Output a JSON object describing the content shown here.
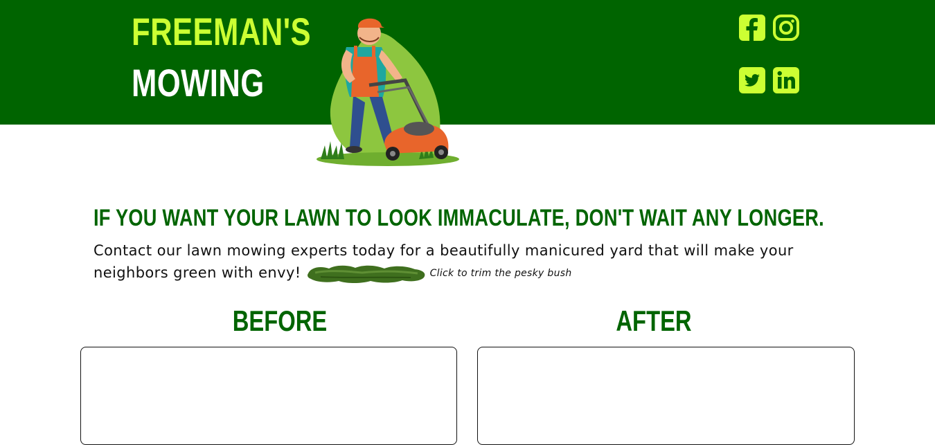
{
  "header": {
    "brand_line1": "FREEMAN'S",
    "brand_line2": "MOWING",
    "colors": {
      "background": "#006400",
      "accent": "#ccff33",
      "white": "#ffffff"
    },
    "social_icons": [
      "facebook-icon",
      "instagram-icon",
      "twitter-icon",
      "linkedin-icon"
    ]
  },
  "hero": {
    "headline": "IF YOU WANT YOUR LAWN TO LOOK IMMACULATE, DON'T WAIT ANY LONGER.",
    "body": "Contact our lawn mowing experts today for a beautifully manicured yard that will make your neighbors green with envy!",
    "bush_hint": "Click to trim the pesky bush"
  },
  "comparison": {
    "before_label": "BEFORE",
    "after_label": "AFTER"
  }
}
